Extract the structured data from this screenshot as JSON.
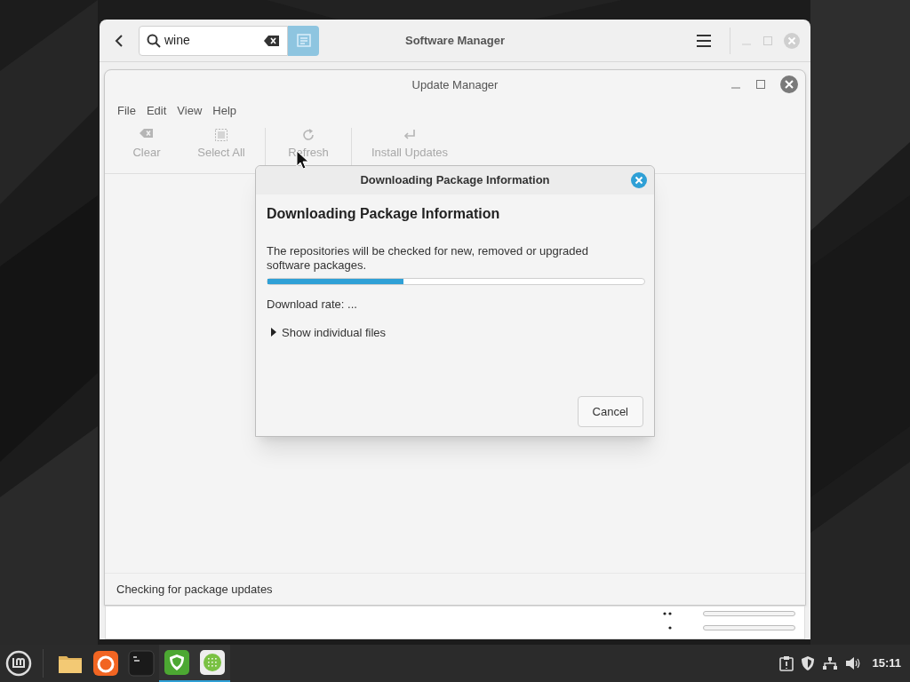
{
  "software_manager": {
    "title": "Software Manager",
    "search": {
      "value": "wine"
    }
  },
  "update_manager": {
    "title": "Update Manager",
    "menu": [
      "File",
      "Edit",
      "View",
      "Help"
    ],
    "toolbar": [
      {
        "label": "Clear",
        "kind": "clear",
        "disabled": true
      },
      {
        "label": "Select All",
        "kind": "select",
        "disabled": true
      },
      {
        "label": "Refresh",
        "kind": "refresh",
        "disabled": true
      },
      {
        "label": "Install Updates",
        "kind": "install",
        "disabled": true
      }
    ],
    "status_bar": "Checking for package updates"
  },
  "dialog": {
    "title": "Downloading Package Information",
    "heading": "Downloading Package Information",
    "text": "The repositories will be checked for new, removed or upgraded software packages.",
    "progress": {
      "level": 0.36
    },
    "download_rate": "Download rate: ...",
    "expander": {
      "label": "Show individual files",
      "expanded": false
    },
    "buttons": [
      "Cancel"
    ]
  },
  "taskbar": {
    "apps": [
      {
        "kind": "folder",
        "active": false
      },
      {
        "kind": "firefox",
        "active": false
      },
      {
        "kind": "terminal",
        "active": false
      },
      {
        "kind": "shield",
        "active": true
      },
      {
        "kind": "grid",
        "active": true
      }
    ],
    "clock": "15:11"
  }
}
